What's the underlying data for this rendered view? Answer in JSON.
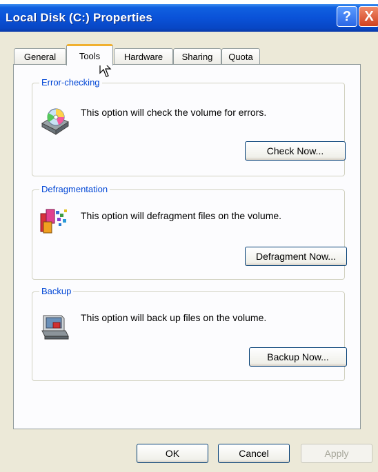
{
  "window": {
    "title": "Local Disk (C:) Properties",
    "help_label": "?",
    "close_label": "X"
  },
  "tabs": [
    {
      "label": "General",
      "active": false
    },
    {
      "label": "Tools",
      "active": true
    },
    {
      "label": "Hardware",
      "active": false
    },
    {
      "label": "Sharing",
      "active": false
    },
    {
      "label": "Quota",
      "active": false
    }
  ],
  "groups": {
    "error_checking": {
      "label": "Error-checking",
      "text": "This option will check the volume for errors.",
      "button": "Check Now...",
      "icon": "disk-check-icon"
    },
    "defragmentation": {
      "label": "Defragmentation",
      "text": "This option will defragment files on the volume.",
      "button": "Defragment Now...",
      "icon": "defragment-icon"
    },
    "backup": {
      "label": "Backup",
      "text": "This option will back up files on the volume.",
      "button": "Backup Now...",
      "icon": "backup-icon"
    }
  },
  "footer": {
    "ok": "OK",
    "cancel": "Cancel",
    "apply": "Apply"
  },
  "colors": {
    "titlebar": "#0a52d8",
    "group_label": "#0046d5",
    "active_tab_accent": "#f0b030"
  }
}
